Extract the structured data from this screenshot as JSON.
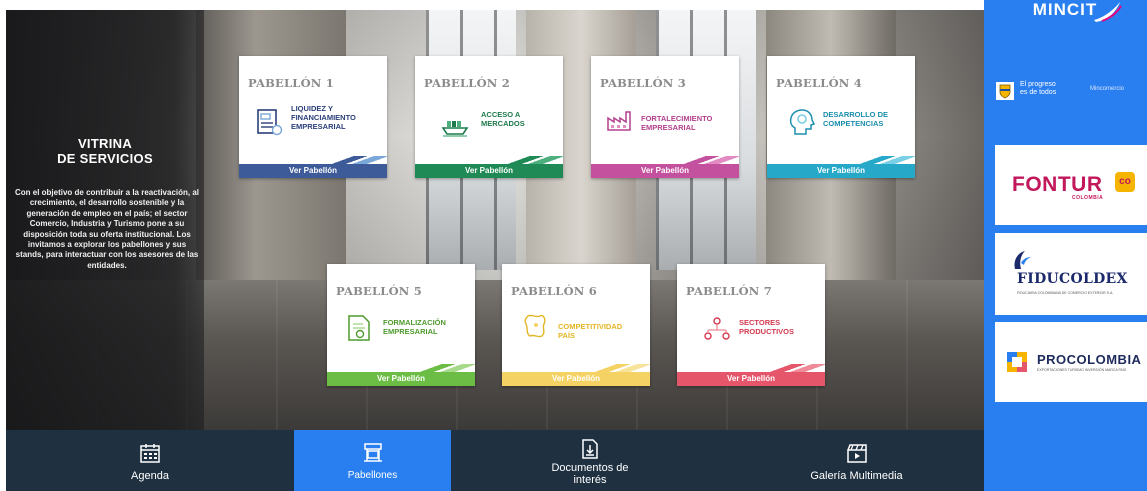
{
  "sidebar_info": {
    "title_line1": "VITRINA",
    "title_line2": "DE SERVICIOS",
    "body": "Con el objetivo de contribuir a la reactivación, al crecimiento, el desarrollo sostenible y la generación de empleo en el país; el sector Comercio, Industria y Turismo pone a su disposición toda su oferta institucional. Los invitamos a explorar los pabellones y sus stands, para interactuar con los asesores de las entidades."
  },
  "pavilions": [
    {
      "title": "PABELLÓN 1",
      "label": [
        "LIQUIDEZ Y",
        "FINANCIAMIENTO",
        "EMPRESARIAL"
      ],
      "button": "Ver Pabellón",
      "accent": "#3d5a99",
      "accent2": "#7aa7d8",
      "label_color": "#2b3f7a",
      "icon": "document-money-icon"
    },
    {
      "title": "PABELLÓN 2",
      "label": [
        "ACCESO A",
        "MERCADOS"
      ],
      "button": "Ver Pabellón",
      "accent": "#1f8a55",
      "accent2": "#4caf7d",
      "label_color": "#1f7a4c",
      "icon": "ship-icon"
    },
    {
      "title": "PABELLÓN 3",
      "label": [
        "FORTALECIMIENTO",
        "EMPRESARIAL"
      ],
      "button": "Ver Pabellón",
      "accent": "#c4519e",
      "accent2": "#e28bc3",
      "label_color": "#b3418d",
      "icon": "factory-icon"
    },
    {
      "title": "PABELLÓN 4",
      "label": [
        "DESARROLLO DE",
        "COMPETENCIAS"
      ],
      "button": "Ver Pabellón",
      "accent": "#26a9c9",
      "accent2": "#79cfe3",
      "label_color": "#1b8fae",
      "icon": "head-gear-icon"
    },
    {
      "title": "PABELLÓN 5",
      "label": [
        "FORMALIZACIÓN",
        "EMPRESARIAL"
      ],
      "button": "Ver Pabellón",
      "accent": "#6cbd45",
      "accent2": "#a6d98a",
      "label_color": "#4f9a2f",
      "icon": "certificate-icon"
    },
    {
      "title": "PABELLÓN 6",
      "label": [
        "COMPETITIVIDAD",
        "PAÍS"
      ],
      "button": "Ver Pabellón",
      "accent": "#f4d263",
      "accent2": "#f8e39a",
      "label_color": "#e3b623",
      "icon": "map-icon"
    },
    {
      "title": "PABELLÓN 7",
      "label": [
        "SECTORES",
        "PRODUCTIVOS"
      ],
      "button": "Ver Pabellón",
      "accent": "#e5566b",
      "accent2": "#f08a99",
      "label_color": "#d33a51",
      "icon": "network-people-icon"
    }
  ],
  "right_column": {
    "brand": "MINCIT",
    "gov_slogan_line1": "El progreso",
    "gov_slogan_line2": "es de todos",
    "gov_ministry": "Mincomercio",
    "fontur": {
      "word": "FONTUR",
      "badge": "co",
      "sub": "COLOMBIA"
    },
    "fiducoldex": {
      "word": "FIDUCOLDEX",
      "sub": "FIDUCIARIA COLOMBIANA DE COMERCIO EXTERIOR S.A."
    },
    "procolombia": {
      "word": "PROCOLOMBIA",
      "sub": "EXPORTACIONES TURISMO INVERSIÓN MARCA PAÍS"
    }
  },
  "bottom_nav": [
    {
      "label_line1": "Agenda",
      "label_line2": "",
      "icon": "calendar-icon",
      "active": false
    },
    {
      "label_line1": "Pabellones",
      "label_line2": "",
      "icon": "stand-icon",
      "active": true
    },
    {
      "label_line1": "Documentos de",
      "label_line2": "interés",
      "icon": "document-download-icon",
      "active": false
    },
    {
      "label_line1": "Galería Multimedia",
      "label_line2": "",
      "icon": "clapperboard-icon",
      "active": false
    }
  ],
  "colors": {
    "nav_bg": "#1f3041",
    "brand_blue": "#2a7ff0",
    "fontur_pink": "#c2185b"
  }
}
